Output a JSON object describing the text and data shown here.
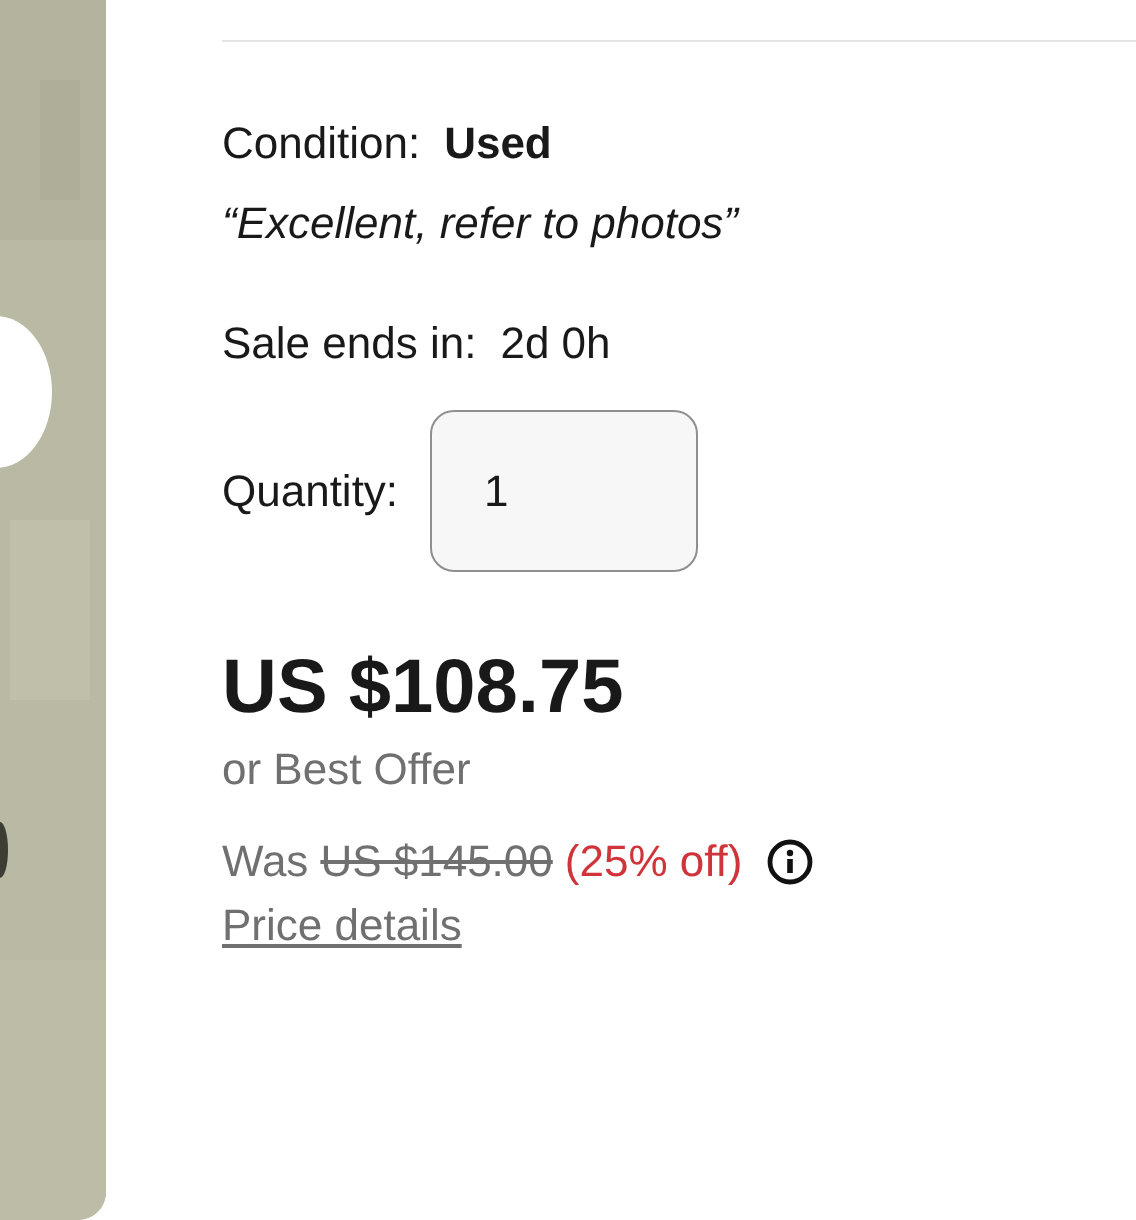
{
  "condition": {
    "label": "Condition:",
    "value": "Used",
    "note": "“Excellent, refer to photos”"
  },
  "sale_ends": {
    "label": "Sale ends in:",
    "value": "2d 0h"
  },
  "quantity": {
    "label": "Quantity:",
    "value": "1"
  },
  "price": "US $108.75",
  "offer": "or Best Offer",
  "was": {
    "label": "Was",
    "original_price": "US $145.00",
    "discount": "(25% off)"
  },
  "price_details_link": "Price details"
}
